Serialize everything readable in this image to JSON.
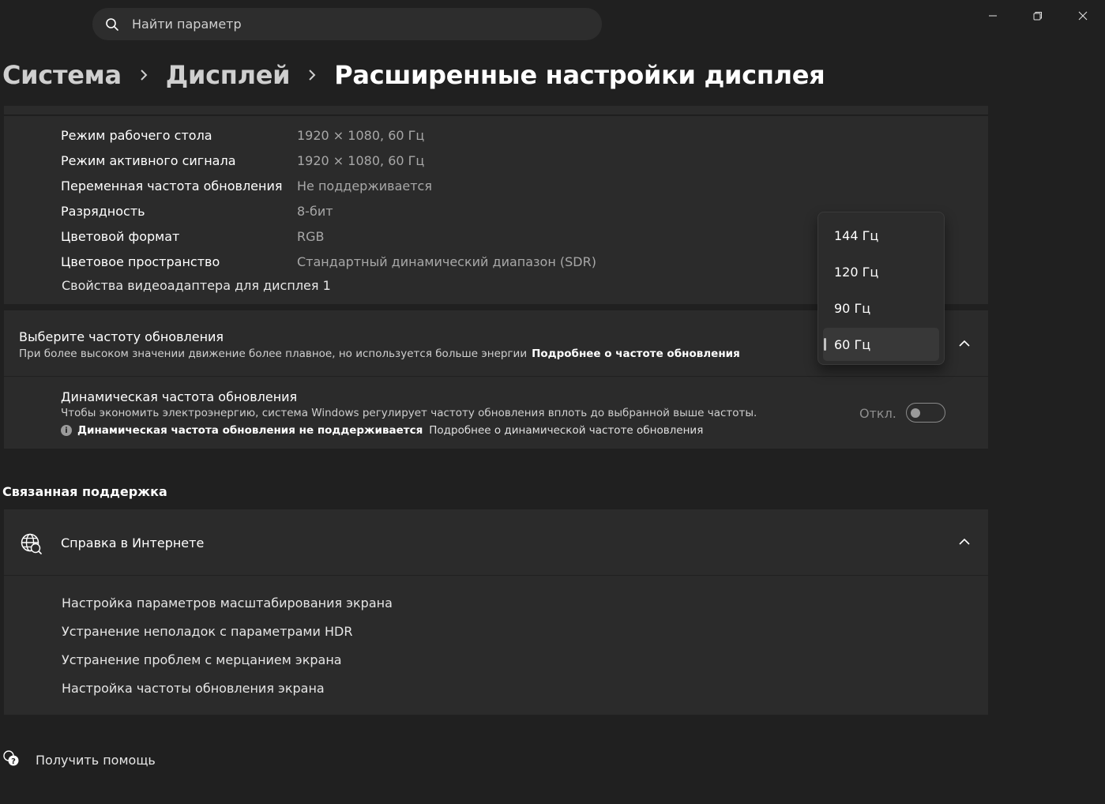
{
  "search": {
    "placeholder": "Найти параметр"
  },
  "breadcrumb": {
    "items": [
      "Система",
      "Дисплей"
    ],
    "current": "Расширенные настройки дисплея"
  },
  "display_info": {
    "rows": [
      {
        "label": "Режим рабочего стола",
        "value": "1920 × 1080, 60 Гц"
      },
      {
        "label": "Режим активного сигнала",
        "value": "1920 × 1080, 60 Гц"
      },
      {
        "label": "Переменная частота обновления",
        "value": "Не поддерживается"
      },
      {
        "label": "Разрядность",
        "value": "8-бит"
      },
      {
        "label": "Цветовой формат",
        "value": "RGB"
      },
      {
        "label": "Цветовое пространство",
        "value": "Стандартный динамический диапазон (SDR)"
      }
    ],
    "adapter_link": "Свойства видеоадаптера для дисплея 1"
  },
  "refresh_rate": {
    "title": "Выберите частоту обновления",
    "description": "При более высоком значении движение более плавное, но используется больше энергии",
    "learn_more": "Подробнее о частоте обновления",
    "options": [
      "144 Гц",
      "120 Гц",
      "90 Гц",
      "60 Гц"
    ],
    "selected": "60 Гц"
  },
  "dynamic_rate": {
    "title": "Динамическая частота обновления",
    "description": "Чтобы экономить электроэнергию, система Windows регулирует частоту обновления вплоть до выбранной выше частоты.",
    "note_bold": "Динамическая частота обновления не поддерживается",
    "note_link": "Подробнее о динамической частоте обновления",
    "toggle_label": "Откл."
  },
  "related_support": {
    "section_title": "Связанная поддержка",
    "help_title": "Справка в Интернете",
    "links": [
      "Настройка параметров масштабирования экрана",
      "Устранение неполадок с параметрами HDR",
      "Устранение проблем с мерцанием экрана",
      "Настройка частоты обновления экрана"
    ]
  },
  "get_help": {
    "label": "Получить помощь"
  }
}
